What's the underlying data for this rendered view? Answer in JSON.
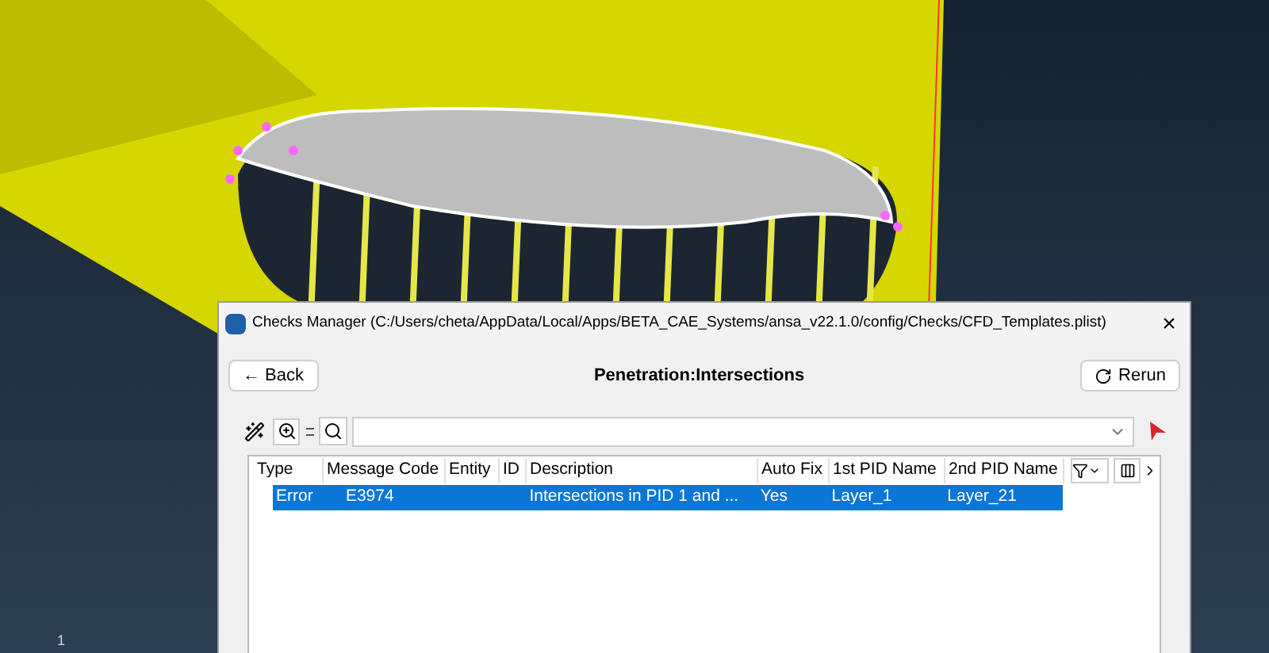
{
  "viewport": {
    "axis_label": "1"
  },
  "window": {
    "title": "Checks Manager (C:/Users/cheta/AppData/Local/Apps/BETA_CAE_Systems/ansa_v22.1.0/config/Checks/CFD_Templates.plist)",
    "close": "×"
  },
  "header": {
    "back": "← Back",
    "title": "Penetration:Intersections",
    "rerun": "Rerun"
  },
  "table": {
    "columns": [
      "Type",
      "Message Code",
      "Entity",
      "ID",
      "Description",
      "Auto Fix",
      "1st PID Name",
      "2nd PID Name"
    ],
    "rows": [
      {
        "selected": true,
        "cells": [
          "Error",
          "E3974",
          "",
          "",
          "Intersections in PID 1 and ...",
          "Yes",
          "Layer_1",
          "Layer_21"
        ]
      }
    ]
  }
}
